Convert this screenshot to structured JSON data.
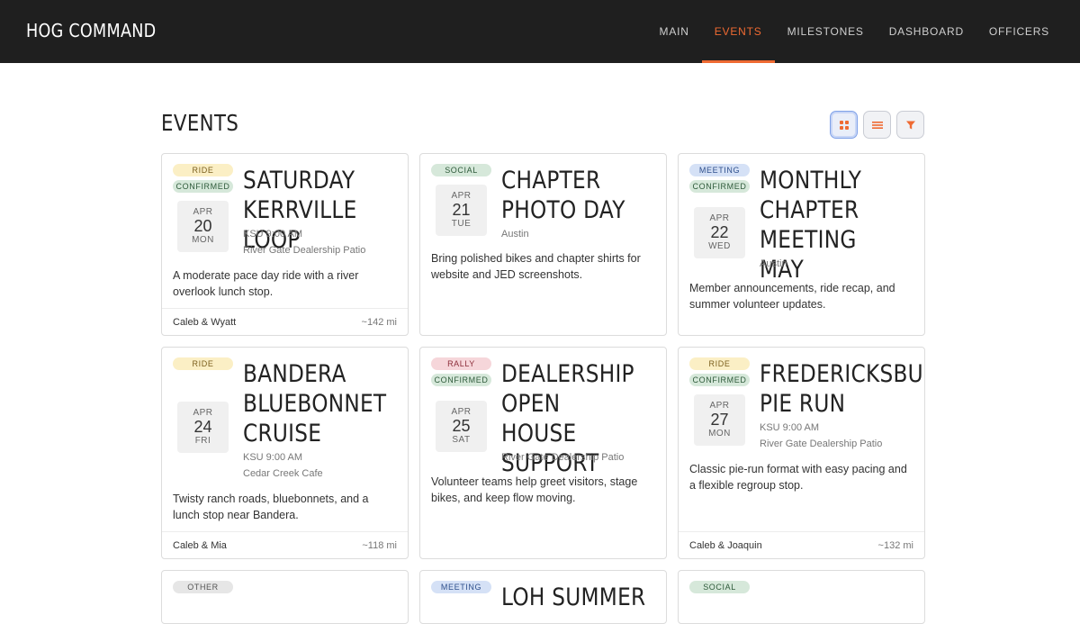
{
  "app": {
    "title": "HOG COMMAND"
  },
  "nav": [
    {
      "label": "MAIN"
    },
    {
      "label": "EVENTS"
    },
    {
      "label": "MILESTONES"
    },
    {
      "label": "DASHBOARD"
    },
    {
      "label": "OFFICERS"
    }
  ],
  "page": {
    "title": "EVENTS"
  },
  "view_buttons": {
    "grid_icon": "grid-icon",
    "list_icon": "list-icon",
    "filter_icon": "filter-icon",
    "accent": "#ef6a32"
  },
  "events": [
    {
      "badges": [
        "RIDE",
        "CONFIRMED"
      ],
      "title": "SATURDAY KERRVILLE LOOP",
      "month": "APR",
      "day": "20",
      "dow": "MON",
      "time": "KSU 9:00 AM",
      "location": "River Gate Dealership Patio",
      "description": "A moderate pace day ride with a river overlook lunch stop.",
      "hosts": "Caleb & Wyatt",
      "distance": "~142 mi"
    },
    {
      "badges": [
        "SOCIAL"
      ],
      "title": "CHAPTER PHOTO DAY",
      "month": "APR",
      "day": "21",
      "dow": "TUE",
      "time": "",
      "location": "Austin",
      "description": "Bring polished bikes and chapter shirts for website and JED screenshots.",
      "hosts": "",
      "distance": ""
    },
    {
      "badges": [
        "MEETING",
        "CONFIRMED"
      ],
      "title": "MONTHLY CHAPTER MEETING MAY",
      "month": "APR",
      "day": "22",
      "dow": "WED",
      "time": "",
      "location": "Austin",
      "description": "Member announcements, ride recap, and summer volunteer updates.",
      "hosts": "",
      "distance": ""
    },
    {
      "badges": [
        "RIDE"
      ],
      "title": "BANDERA BLUEBONNET CRUISE",
      "month": "APR",
      "day": "24",
      "dow": "FRI",
      "time": "KSU 9:00 AM",
      "location": "Cedar Creek Cafe",
      "description": "Twisty ranch roads, bluebonnets, and a lunch stop near Bandera.",
      "hosts": "Caleb & Mia",
      "distance": "~118 mi"
    },
    {
      "badges": [
        "RALLY",
        "CONFIRMED"
      ],
      "title": "DEALERSHIP OPEN HOUSE SUPPORT",
      "month": "APR",
      "day": "25",
      "dow": "SAT",
      "time": "",
      "location": "River Gate Dealership Patio",
      "description": "Volunteer teams help greet visitors, stage bikes, and keep flow moving.",
      "hosts": "",
      "distance": ""
    },
    {
      "badges": [
        "RIDE",
        "CONFIRMED"
      ],
      "title": "FREDERICKSBURG PIE RUN",
      "month": "APR",
      "day": "27",
      "dow": "MON",
      "time": "KSU 9:00 AM",
      "location": "River Gate Dealership Patio",
      "description": "Classic pie-run format with easy pacing and a flexible regroup stop.",
      "hosts": "Caleb & Joaquin",
      "distance": "~132 mi"
    },
    {
      "badges": [
        "OTHER"
      ],
      "title": "",
      "partial": true
    },
    {
      "badges": [
        "MEETING"
      ],
      "title": "LOH SUMMER",
      "partial": true
    },
    {
      "badges": [
        "SOCIAL"
      ],
      "title": "",
      "partial": true
    }
  ]
}
